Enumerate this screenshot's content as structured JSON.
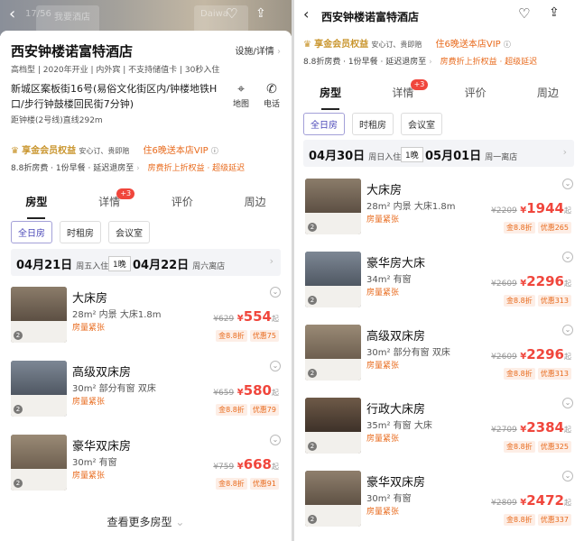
{
  "left": {
    "hero_ghost": [
      "17/56",
      "我要酒店",
      "Daiwa"
    ],
    "hotel_name": "西安钟楼诺富特酒店",
    "facility_link": "设施/详情",
    "tags": "高档型 | 2020年开业 | 内外宾 | 不支持储值卡 | 30秒入住",
    "address": "新城区案板街16号(易俗文化街区内/钟楼地铁H口/步行钟鼓楼回民街7分钟)",
    "distance": "距钟楼(2号线)直线292m",
    "map_label": "地图",
    "phone_label": "电话",
    "member": {
      "title": "享金会员权益",
      "subtitle": "安心订、贵即赔",
      "promo": "住6晚送本店VIP",
      "perks": "8.8折房费 · 1份早餐 · 延迟退房至",
      "promo_perks": "房费折上折权益 · 超级延迟"
    },
    "tabs": [
      {
        "label": "房型"
      },
      {
        "label": "详情",
        "badge": "+3"
      },
      {
        "label": "评价"
      },
      {
        "label": "周边"
      }
    ],
    "chips": [
      "全日房",
      "时租房",
      "会议室"
    ],
    "date_bar": {
      "checkin": "04月21日",
      "checkin_week": "周五入住",
      "nights": "1晚",
      "checkout": "04月22日",
      "checkout_week": "周六离店"
    },
    "rooms": [
      {
        "name": "大床房",
        "spec": "28m² 内景 大床1.8m",
        "status": "房量紧张",
        "orig": "¥629",
        "price": "554",
        "suffix": "起",
        "discount": "金8.8折",
        "save": "优惠75"
      },
      {
        "name": "高级双床房",
        "spec": "30m² 部分有窗 双床",
        "status": "房量紧张",
        "orig": "¥659",
        "price": "580",
        "suffix": "起",
        "discount": "金8.8折",
        "save": "优惠79"
      },
      {
        "name": "豪华双床房",
        "spec": "30m² 有窗",
        "status": "房量紧张",
        "orig": "¥759",
        "price": "668",
        "suffix": "起",
        "discount": "金8.8折",
        "save": "优惠91"
      }
    ],
    "more": "查看更多房型"
  },
  "right": {
    "title": "西安钟楼诺富特酒店",
    "member": {
      "title": "享金会员权益",
      "subtitle": "安心订、贵即赔",
      "promo": "住6晚送本店VIP",
      "perks": "8.8折房费 · 1份早餐 · 延迟退房至",
      "promo_perks": "房费折上折权益 · 超级延迟"
    },
    "tabs": [
      {
        "label": "房型"
      },
      {
        "label": "详情",
        "badge": "+3"
      },
      {
        "label": "评价"
      },
      {
        "label": "周边"
      }
    ],
    "chips": [
      "全日房",
      "时租房",
      "会议室"
    ],
    "date_bar": {
      "checkin": "04月30日",
      "checkin_week": "周日入住",
      "nights": "1晚",
      "checkout": "05月01日",
      "checkout_week": "周一离店"
    },
    "rooms": [
      {
        "name": "大床房",
        "spec": "28m² 内景 大床1.8m",
        "status": "房量紧张",
        "orig": "¥2209",
        "price": "1944",
        "suffix": "起",
        "discount": "金8.8折",
        "save": "优惠265"
      },
      {
        "name": "豪华房大床",
        "spec": "34m² 有窗",
        "status": "房量紧张",
        "orig": "¥2609",
        "price": "2296",
        "suffix": "起",
        "discount": "金8.8折",
        "save": "优惠313"
      },
      {
        "name": "高级双床房",
        "spec": "30m² 部分有窗 双床",
        "status": "房量紧张",
        "orig": "¥2609",
        "price": "2296",
        "suffix": "起",
        "discount": "金8.8折",
        "save": "优惠313"
      },
      {
        "name": "行政大床房",
        "spec": "35m² 有窗 大床",
        "status": "房量紧张",
        "orig": "¥2709",
        "price": "2384",
        "suffix": "起",
        "discount": "金8.8折",
        "save": "优惠325"
      },
      {
        "name": "豪华双床房",
        "spec": "30m² 有窗",
        "status": "房量紧张",
        "orig": "¥2809",
        "price": "2472",
        "suffix": "起",
        "discount": "金8.8折",
        "save": "优惠337"
      }
    ]
  },
  "colors": {
    "accent": "#f0463c",
    "orange": "#e86a1c",
    "gold": "#c9952d",
    "chip_active": "#4a47b8"
  }
}
